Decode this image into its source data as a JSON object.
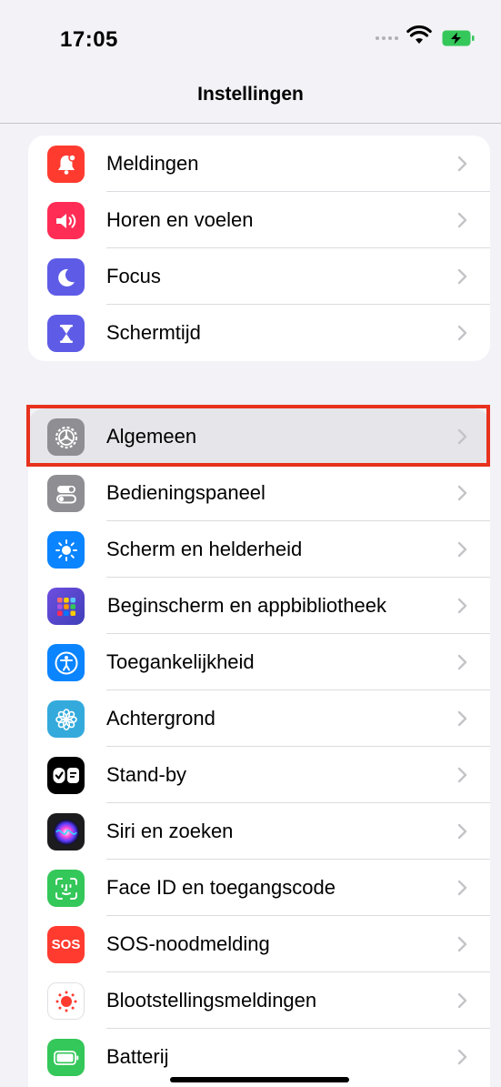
{
  "status_bar": {
    "time": "17:05"
  },
  "nav": {
    "title": "Instellingen"
  },
  "group1": [
    {
      "label": "Meldingen",
      "icon": "bell-icon",
      "color": "#ff3b30"
    },
    {
      "label": "Horen en voelen",
      "icon": "speaker-icon",
      "color": "#ff2d55"
    },
    {
      "label": "Focus",
      "icon": "moon-icon",
      "color": "#5e5ce6"
    },
    {
      "label": "Schermtijd",
      "icon": "hourglass-icon",
      "color": "#5e5ce6"
    }
  ],
  "group2": [
    {
      "label": "Algemeen",
      "icon": "gear-icon",
      "color": "#8e8e93",
      "highlighted": true
    },
    {
      "label": "Bedieningspaneel",
      "icon": "toggles-icon",
      "color": "#8e8e93"
    },
    {
      "label": "Scherm en helderheid",
      "icon": "sun-icon",
      "color": "#0a84ff"
    },
    {
      "label": "Beginscherm en appbibliotheek",
      "icon": "app-grid-icon",
      "color": "#5856d6"
    },
    {
      "label": "Toegankelijkheid",
      "icon": "accessibility-icon",
      "color": "#0a84ff"
    },
    {
      "label": "Achtergrond",
      "icon": "flower-icon",
      "color": "#34aadc"
    },
    {
      "label": "Stand-by",
      "icon": "standby-icon",
      "color": "#000000"
    },
    {
      "label": "Siri en zoeken",
      "icon": "siri-icon",
      "color": "#1c1c1e"
    },
    {
      "label": "Face ID en toegangscode",
      "icon": "face-id-icon",
      "color": "#34c759"
    },
    {
      "label": "SOS-noodmelding",
      "icon": "sos-icon",
      "color": "#ff3b30",
      "icon_text": "SOS"
    },
    {
      "label": "Blootstellingsmeldingen",
      "icon": "exposure-icon",
      "color": "#ffffff"
    },
    {
      "label": "Batterij",
      "icon": "battery-icon",
      "color": "#34c759"
    }
  ]
}
